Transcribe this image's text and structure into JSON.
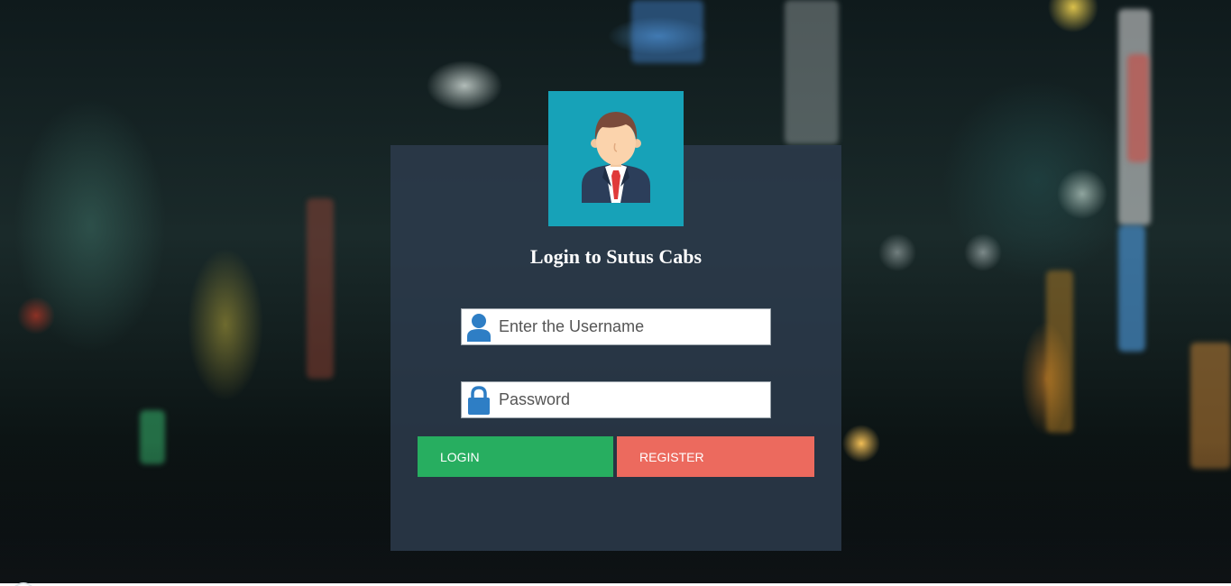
{
  "login_card": {
    "title": "Login to Sutus Cabs",
    "avatar_icon": "businessman-avatar-icon",
    "username": {
      "icon": "user-icon",
      "placeholder": "Enter the Username",
      "value": ""
    },
    "password": {
      "icon": "lock-icon",
      "placeholder": "Password",
      "value": ""
    },
    "login_label": "LOGIN",
    "register_label": "REGISTER"
  },
  "colors": {
    "avatar_background": "#17a2b8",
    "login_button": "#27ae60",
    "register_button": "#ec6a5e",
    "field_icon": "#2e7ec5",
    "panel": "rgba(45,60,78,0.82)"
  }
}
